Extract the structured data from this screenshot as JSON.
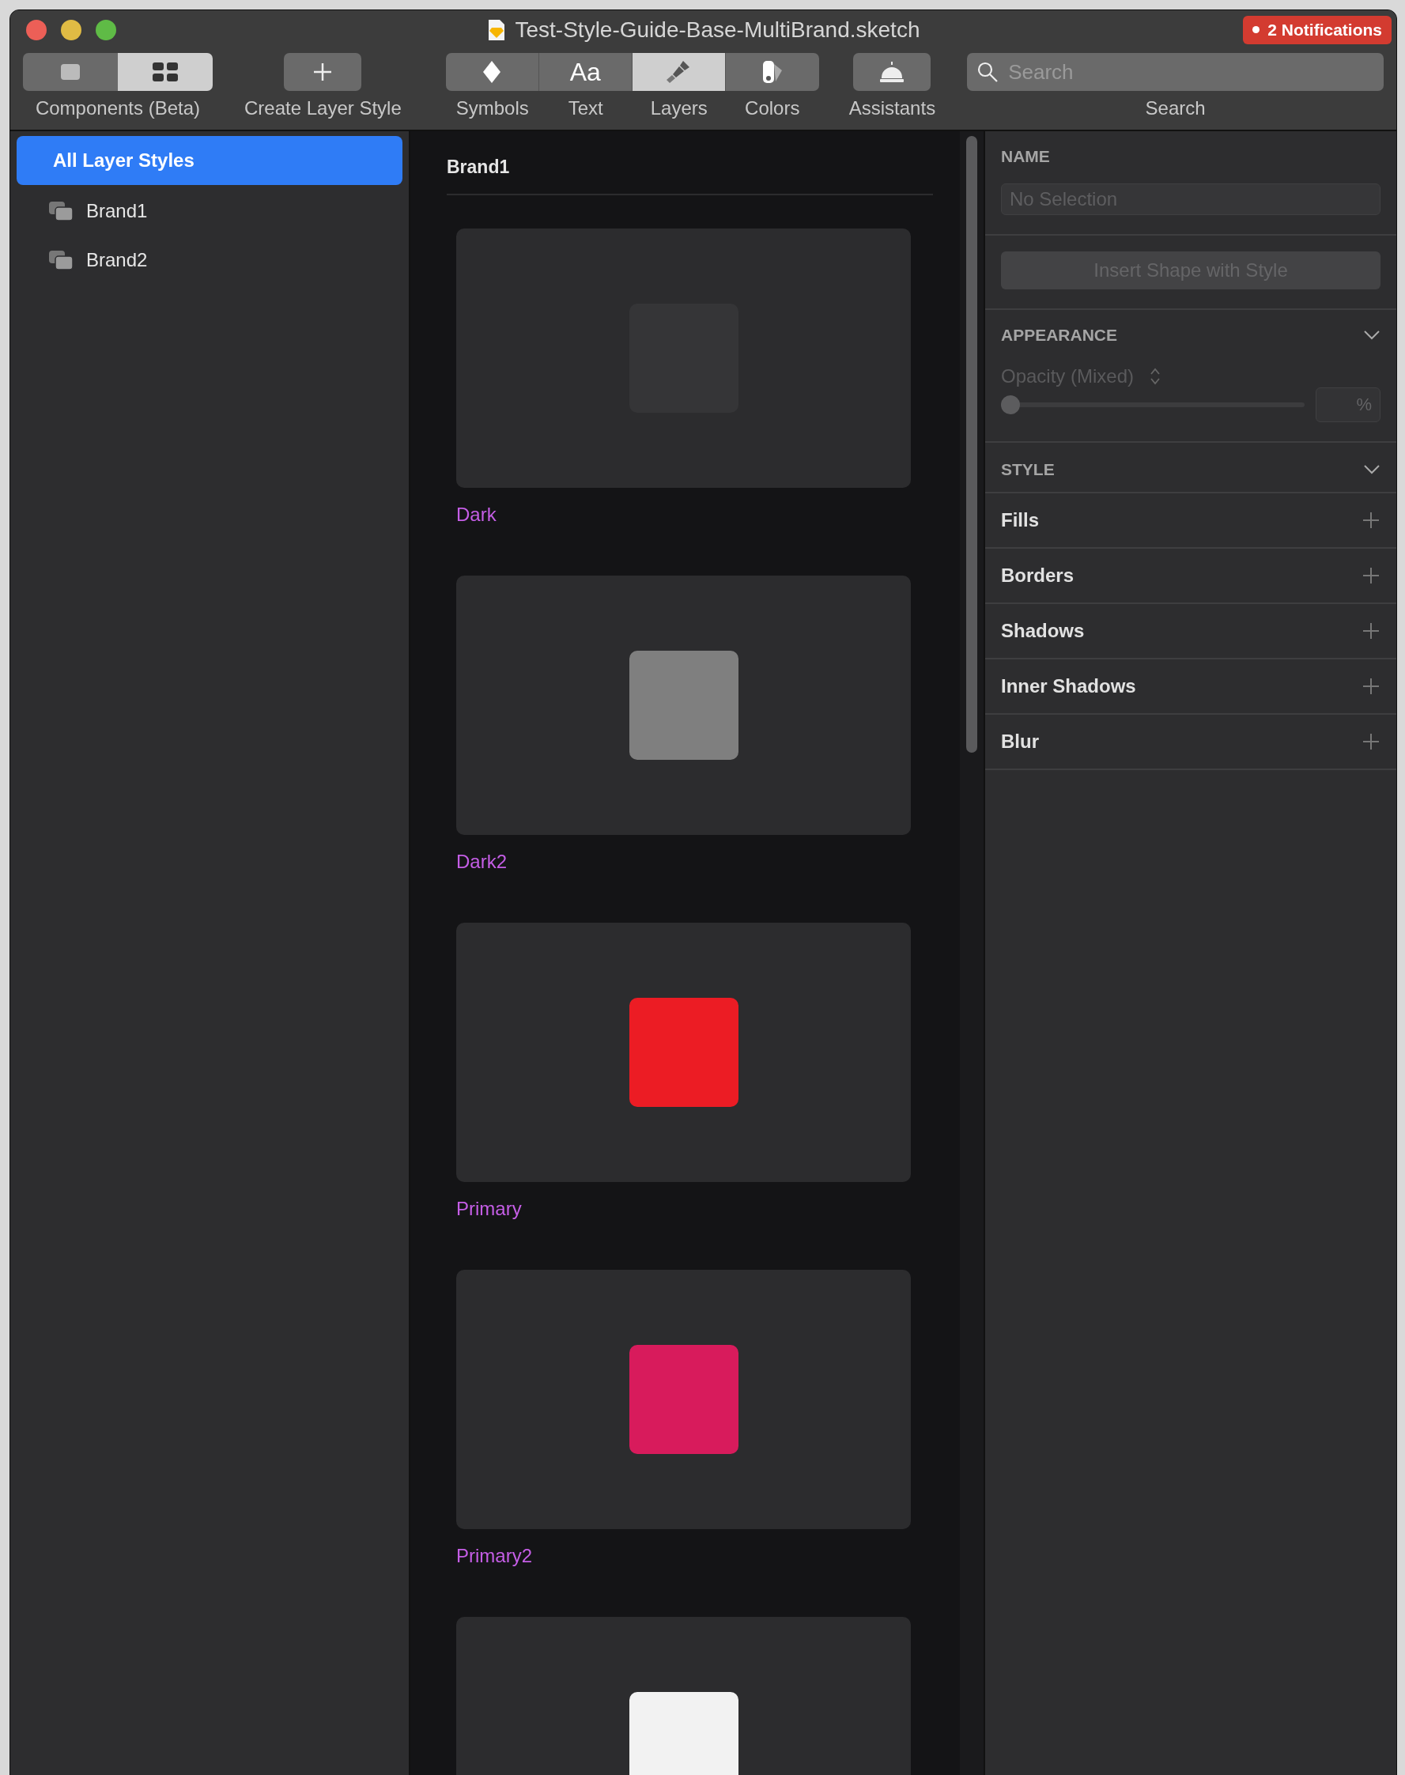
{
  "window": {
    "title": "Test-Style-Guide-Base-MultiBrand.sketch",
    "notification": "2 Notifications"
  },
  "toolbar": [
    {
      "kind": "segmented",
      "label": "Components (Beta)",
      "segments": [
        {
          "selected": false
        },
        {
          "selected": true
        }
      ]
    },
    {
      "kind": "button",
      "label": "Create Layer Style"
    },
    {
      "kind": "tabs",
      "items": [
        {
          "label": "Symbols",
          "selected": false
        },
        {
          "label": "Text",
          "glyph": "Aa",
          "selected": false
        },
        {
          "label": "Layers",
          "selected": true
        },
        {
          "label": "Colors",
          "selected": false
        }
      ]
    },
    {
      "kind": "button",
      "label": "Assistants"
    },
    {
      "kind": "search",
      "placeholder": "Search",
      "label": "Search"
    }
  ],
  "sidebar": {
    "items": [
      {
        "label": "All Layer Styles",
        "selected": true,
        "kind": "all"
      },
      {
        "label": "Brand1",
        "selected": false,
        "kind": "group"
      },
      {
        "label": "Brand2",
        "selected": false,
        "kind": "group"
      }
    ]
  },
  "gallery": {
    "heading": "Brand1",
    "styles": [
      {
        "label": "Dark",
        "color": "#353537"
      },
      {
        "label": "Dark2",
        "color": "#7f7f7f"
      },
      {
        "label": "Primary",
        "color": "#ec1c24"
      },
      {
        "label": "Primary2",
        "color": "#d81b5c"
      },
      {
        "color": "#f2f2f2"
      }
    ]
  },
  "inspector": {
    "name_heading": "NAME",
    "name_placeholder": "No Selection",
    "insert_button": "Insert Shape with Style",
    "appearance": {
      "heading": "APPEARANCE",
      "opacity_label": "Opacity (Mixed)",
      "level": 0,
      "percent": "%"
    },
    "style": {
      "heading": "STYLE",
      "rows": [
        "Fills",
        "Borders",
        "Shadows",
        "Inner Shadows",
        "Blur"
      ]
    }
  }
}
